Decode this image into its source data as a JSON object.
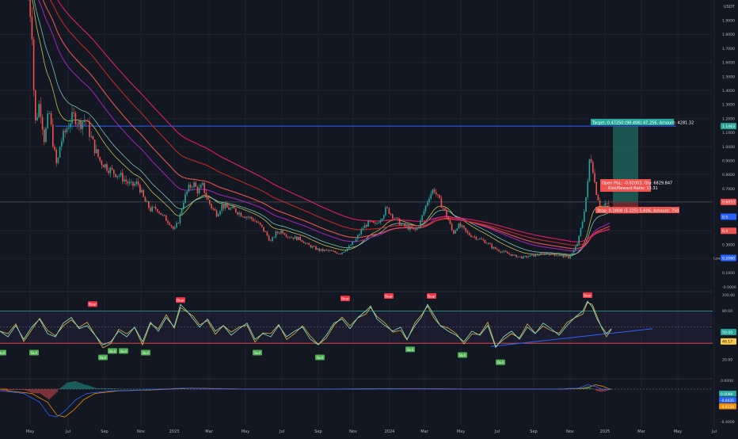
{
  "colors": {
    "background": "#131722",
    "grid": "#1e222d",
    "axis_text": "#b2b5be",
    "up": "#26a69a",
    "down": "#ef5350",
    "resistance": "#2962ff",
    "trendline": "#2962ff",
    "rsi": "#7fd6c2",
    "rsi_signal": "#f7c948",
    "bull_label": "#4caf50",
    "bear_label": "#f23645",
    "target_zone": "#1e5f57",
    "stop_zone": "#7a2a32"
  },
  "price_axis": {
    "currency": "USDT",
    "ticks": [
      "1.9000",
      "1.8000",
      "1.7000",
      "1.6000",
      "1.5000",
      "1.4000",
      "1.3000",
      "1.2000",
      "1.1000",
      "1.0000",
      "0.9000",
      "0.8000",
      "0.7000",
      "0.6000",
      "0.5000",
      "0.4000",
      "0.3000",
      "0.2000",
      "0.1000",
      "-0.0000"
    ],
    "badges": [
      {
        "text": "1.1463",
        "value": 1.1463,
        "color": "#26a69a"
      },
      {
        "text": "0.6053",
        "value": 0.6053,
        "color": "#ef5350"
      },
      {
        "text": "0.5",
        "value": 0.5,
        "color": "#2962ff"
      },
      {
        "text": "0.4",
        "value": 0.4,
        "color": "#ef5350"
      },
      {
        "text": "0.2060",
        "value": 0.206,
        "color": "#2962ff",
        "prefix": "Low"
      }
    ]
  },
  "rsi_axis": {
    "ticks": [
      "100.00",
      "80.00",
      "40.00",
      "20.00"
    ],
    "badges": [
      {
        "text": "50.00",
        "value": 50,
        "color": "#26a69a"
      },
      {
        "text": "46.17",
        "value": 46.17,
        "color": "#f7c948"
      }
    ]
  },
  "macd_axis": {
    "ticks": [
      "0.0000",
      "-0.4000"
    ],
    "badges": [
      {
        "text": "0.0099",
        "color": "#26a69a"
      },
      {
        "text": "-0.0035",
        "color": "#2962ff"
      },
      {
        "text": "-0.0134",
        "color": "#ef8c00"
      }
    ]
  },
  "time_axis": {
    "labels": [
      "May",
      "Jul",
      "Sep",
      "Nov",
      "2023",
      "Mar",
      "May",
      "Jul",
      "Sep",
      "Nov",
      "2024",
      "Mar",
      "May",
      "Jul",
      "Sep",
      "Nov",
      "2025",
      "Mar",
      "May",
      "Jul"
    ]
  },
  "trade": {
    "target_text": "Target: 0.47250 (98.406) 47.256, Amount: 4281.32",
    "open_text_1": "Open P&L: -0.02003, Qty: 6829.847",
    "open_text_2": "Risk/Reward Ratio: 13.31",
    "stop_text": "Stop: 0.3808 (5.225) 5,606, Amount: 750"
  },
  "rsi_labels": [
    "Bear",
    "Bull"
  ],
  "chart_data": [
    {
      "type": "line",
      "panel": "price",
      "ylim": [
        0,
        2.0
      ],
      "x": [
        "May",
        "Jul",
        "Sep",
        "Nov",
        "2023",
        "Mar",
        "May",
        "Jul",
        "Sep",
        "Nov",
        "2024",
        "Mar",
        "May",
        "Jul",
        "Sep",
        "Nov",
        "2025",
        "Mar",
        "May",
        "Jul"
      ],
      "series": [
        {
          "values": [
            2.0,
            1.15,
            0.85,
            0.6,
            0.75,
            0.62,
            0.55,
            0.42,
            0.3,
            0.32,
            0.52,
            0.6,
            0.5,
            0.3,
            0.25,
            0.28,
            0.6,
            null,
            null,
            null
          ]
        }
      ],
      "resistance": 1.1463,
      "target": 1.1463,
      "entry": 0.6053,
      "stop": 0.4,
      "low": 0.206
    },
    {
      "type": "line",
      "panel": "rsi",
      "ylim": [
        0,
        100
      ],
      "x": [
        "May",
        "Jul",
        "Sep",
        "Nov",
        "2023",
        "Mar",
        "May",
        "Jul",
        "Sep",
        "Nov",
        "2024",
        "Mar",
        "May",
        "Jul",
        "Sep",
        "Nov",
        "2025",
        "Mar",
        "May",
        "Jul"
      ],
      "series": [
        {
          "values": [
            55,
            48,
            35,
            60,
            78,
            50,
            45,
            40,
            30,
            55,
            65,
            75,
            50,
            30,
            35,
            45,
            46.17,
            null,
            null,
            null
          ]
        }
      ],
      "bands": [
        80,
        40
      ]
    },
    {
      "type": "bar",
      "panel": "macd",
      "ylim": [
        -0.4,
        0.1
      ],
      "x": [
        "May",
        "Jul",
        "Sep",
        "Nov",
        "2023",
        "Mar",
        "May",
        "Jul",
        "Sep",
        "Nov",
        "2024",
        "Mar",
        "May",
        "Jul",
        "Sep",
        "Nov",
        "2025",
        "Mar",
        "May",
        "Jul"
      ],
      "series": [
        {
          "values": [
            -0.05,
            -0.3,
            -0.1,
            -0.02,
            0.01,
            -0.01,
            0.0,
            0.0,
            0.0,
            0.0,
            0.01,
            0.0,
            0.0,
            0.0,
            0.0,
            0.04,
            0.0099,
            null,
            null,
            null
          ]
        }
      ]
    }
  ]
}
